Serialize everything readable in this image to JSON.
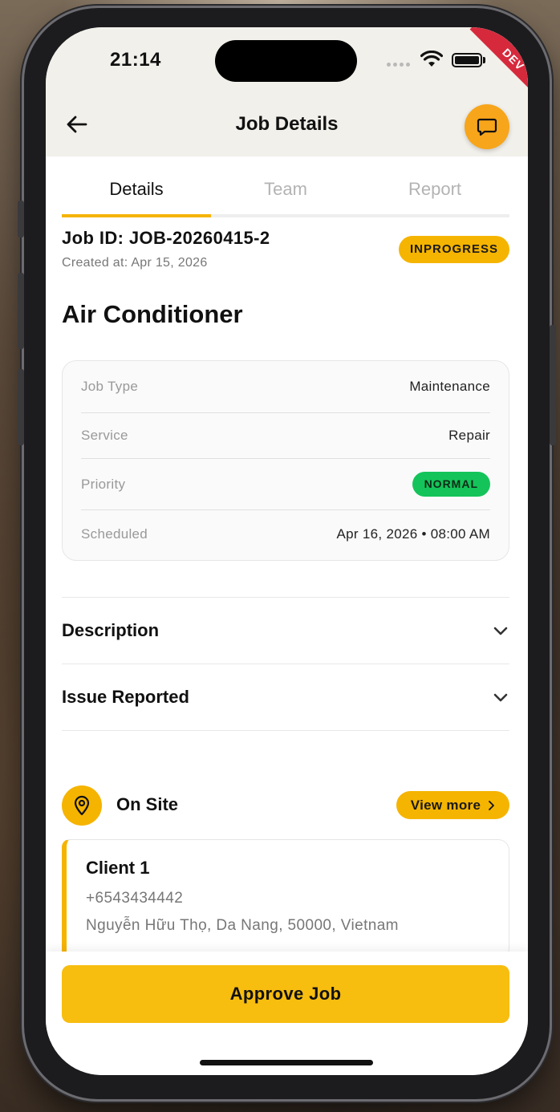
{
  "status_bar": {
    "time": "21:14"
  },
  "dev_ribbon": "DEV",
  "header": {
    "title": "Job Details",
    "back_icon": "arrow-left-icon",
    "chat_icon": "chat-bubble-icon",
    "accent": "#f7a51a"
  },
  "tabs": [
    {
      "label": "Details",
      "active": true
    },
    {
      "label": "Team",
      "active": false
    },
    {
      "label": "Report",
      "active": false
    }
  ],
  "job": {
    "id": "Job ID: JOB-20260415-2",
    "created": "Created at: Apr 15, 2026",
    "status": "INPROGRESS",
    "title": "Air Conditioner"
  },
  "info": {
    "job_type_label": "Job Type",
    "job_type_value": "Maintenance",
    "service_label": "Service",
    "service_value": "Repair",
    "priority_label": "Priority",
    "priority_value": "NORMAL",
    "scheduled_label": "Scheduled",
    "scheduled_value": "Apr 16, 2026 • 08:00 AM"
  },
  "sections": [
    {
      "title": "Description"
    },
    {
      "title": "Issue Reported"
    }
  ],
  "onsite": {
    "label": "On Site",
    "icon": "location-pin-icon",
    "view_more": "View more",
    "client_name": "Client 1",
    "client_phone": "+6543434442",
    "client_address": "Nguyễn Hữu Thọ, Da Nang, 50000, Vietnam"
  },
  "footer": {
    "approve_label": "Approve Job"
  },
  "colors": {
    "primary": "#f5b400",
    "priority_normal": "#14c45a",
    "dev": "#d62a3c"
  }
}
